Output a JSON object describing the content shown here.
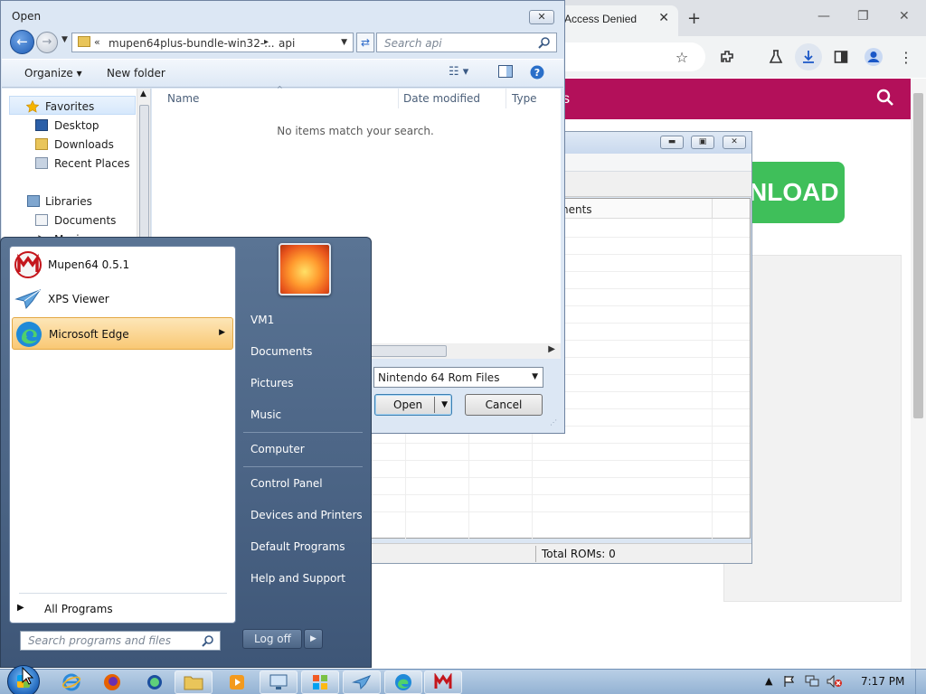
{
  "browser": {
    "tab_title": "Access Denied",
    "site_nav_text": "s",
    "download_button_label": "NLOAD",
    "header_color": "#b3105a",
    "download_color": "#3fbf5a"
  },
  "mupen_window": {
    "column_header": "nents",
    "status_text": "Total ROMs: 0"
  },
  "open_dialog": {
    "title": "Open",
    "address_chevron": "«",
    "address_path": "mupen64plus-bundle-win32-...",
    "address_current": "api",
    "search_placeholder": "Search api",
    "organize_label": "Organize ▾",
    "new_folder_label": "New folder",
    "nav_items": [
      {
        "label": "Favorites"
      },
      {
        "label": "Desktop"
      },
      {
        "label": "Downloads"
      },
      {
        "label": "Recent Places"
      },
      {
        "label": "Libraries"
      },
      {
        "label": "Documents"
      },
      {
        "label": "Music"
      }
    ],
    "columns": [
      "Name",
      "Date modified",
      "Type"
    ],
    "empty_message": "No items match your search.",
    "file_type_filter": "Nintendo 64 Rom Files",
    "open_label": "Open",
    "cancel_label": "Cancel"
  },
  "start_menu": {
    "programs": [
      {
        "label": "Mupen64 0.5.1",
        "icon": "mupen64-icon"
      },
      {
        "label": "XPS Viewer",
        "icon": "xps-viewer-icon"
      },
      {
        "label": "Microsoft Edge",
        "icon": "edge-icon"
      }
    ],
    "all_programs_label": "All Programs",
    "search_placeholder": "Search programs and files",
    "right_links": [
      "VM1",
      "Documents",
      "Pictures",
      "Music",
      "Computer",
      "Control Panel",
      "Devices and Printers",
      "Default Programs",
      "Help and Support"
    ],
    "logoff_label": "Log off"
  },
  "taskbar": {
    "clock": "7:17 PM",
    "apps": [
      "internet-explorer-icon",
      "firefox-icon",
      "app-icon",
      "file-explorer-icon",
      "media-player-icon",
      "remote-desktop-icon",
      "windows-update-icon",
      "xps-viewer-icon",
      "edge-icon",
      "mupen64-icon"
    ]
  }
}
